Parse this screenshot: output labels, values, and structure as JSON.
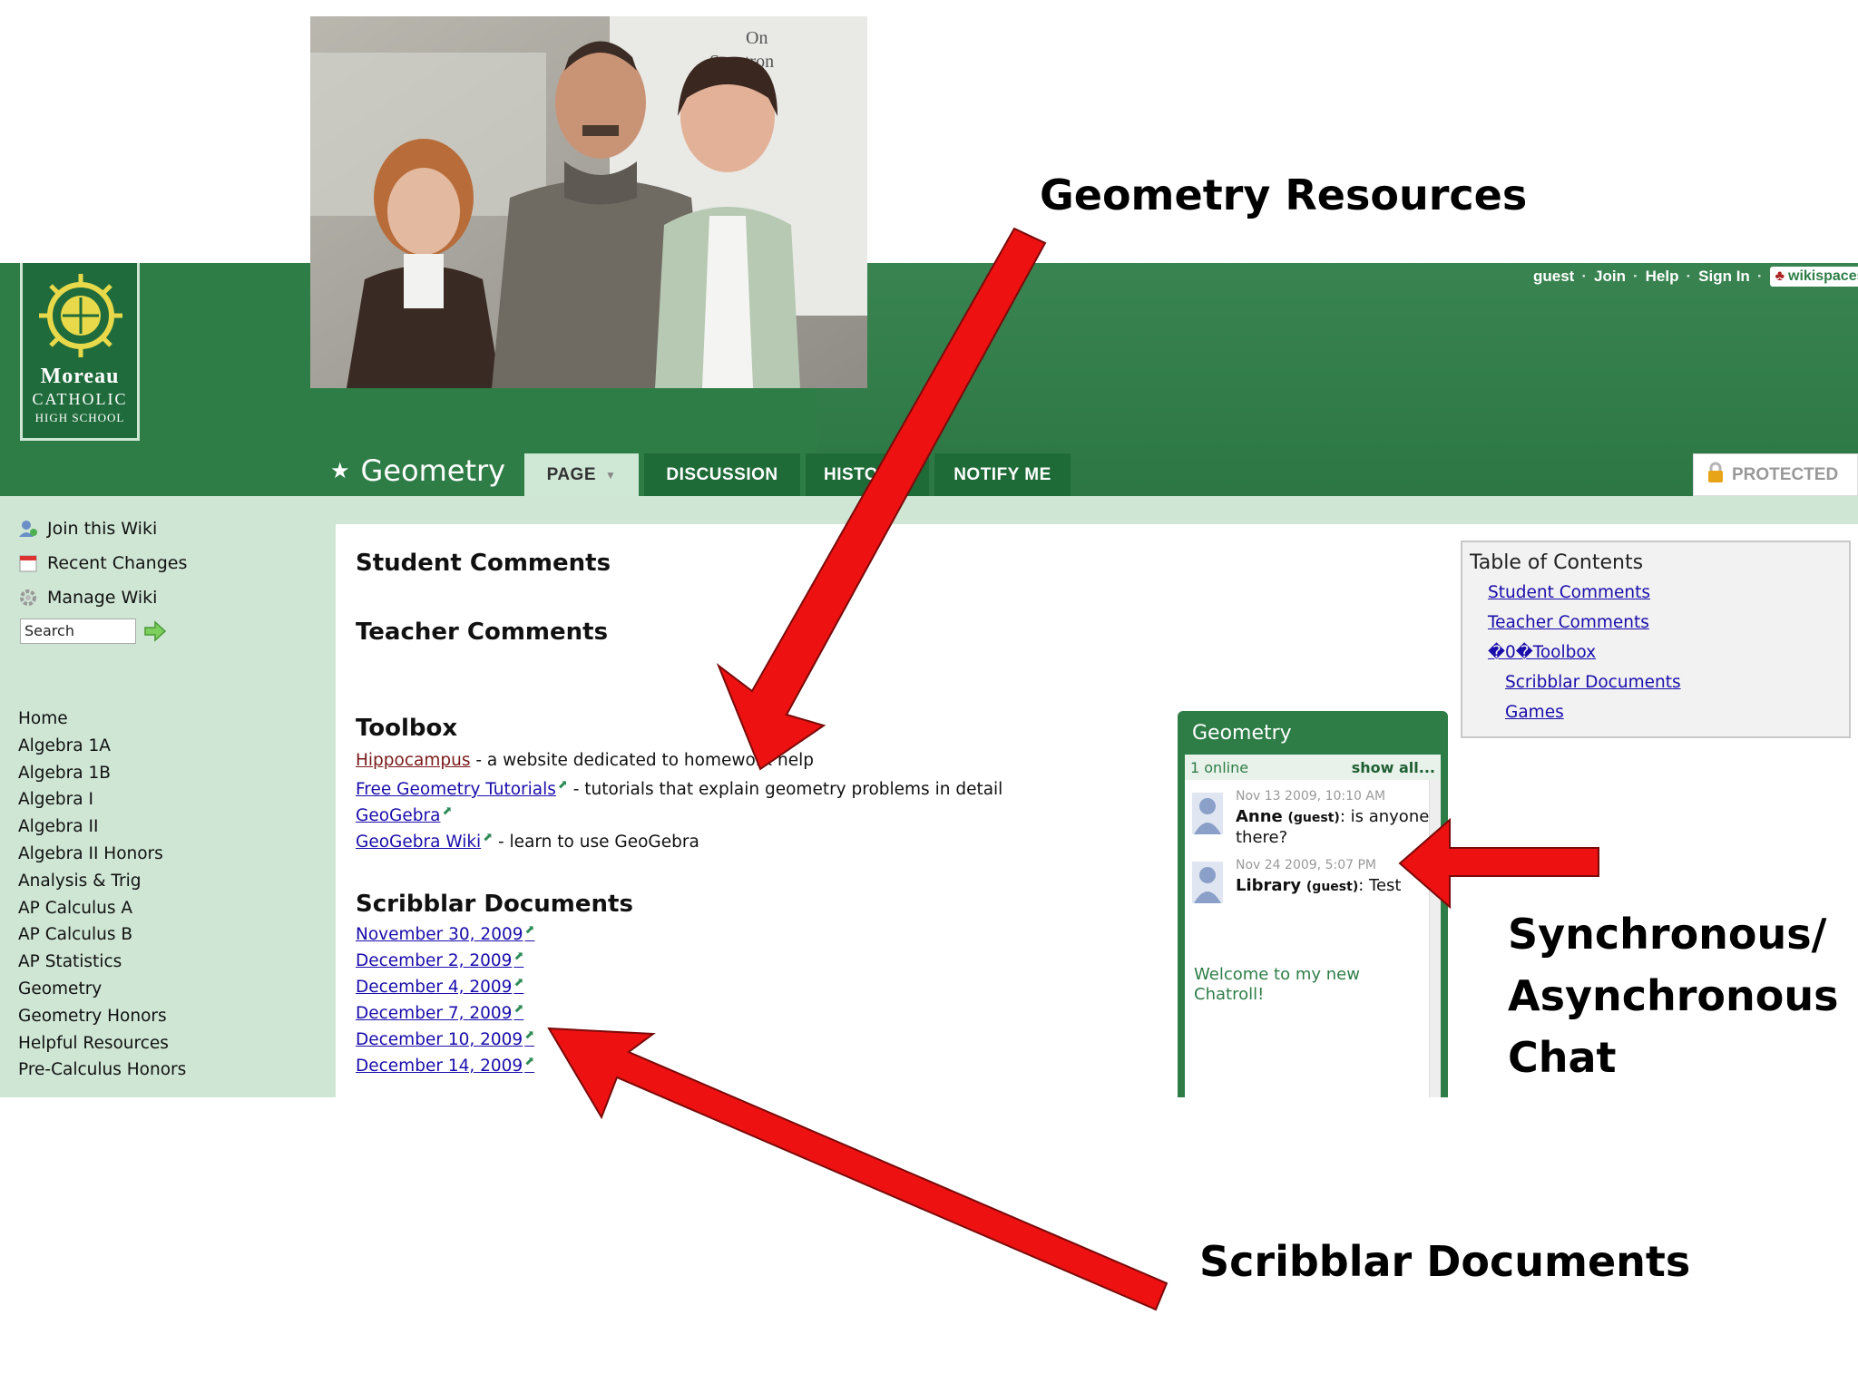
{
  "logo": {
    "line1": "Moreau",
    "line2": "CATHOLIC",
    "line3": "HIGH SCHOOL"
  },
  "user_links": {
    "guest": "guest",
    "join": "Join",
    "help": "Help",
    "sign_in": "Sign In",
    "wikispaces": "wikispaces"
  },
  "page": {
    "title": "Geometry"
  },
  "tabs": {
    "page": "PAGE",
    "discussion": "DISCUSSION",
    "history": "HISTO",
    "notify": "NOTIFY ME",
    "protected": "PROTECTED"
  },
  "sidebar": {
    "actions": [
      "Join this Wiki",
      "Recent Changes",
      "Manage Wiki"
    ],
    "search_value": "Search",
    "nav": [
      "Home",
      "Algebra 1A",
      "Algebra 1B",
      "Algebra I",
      "Algebra II",
      "Algebra II Honors",
      "Analysis & Trig",
      "AP Calculus A",
      "AP Calculus B",
      "AP Statistics",
      "Geometry",
      "Geometry Honors",
      "Helpful Resources",
      "Pre-Calculus Honors"
    ]
  },
  "content": {
    "student_comments": "Student Comments",
    "teacher_comments": "Teacher Comments",
    "toolbox": {
      "heading": "Toolbox",
      "items": [
        {
          "link": "Hippocampus",
          "desc": " - a website dedicated to homework help"
        },
        {
          "link": "Free Geometry Tutorials",
          "desc": " - tutorials that explain geometry problems in detail"
        },
        {
          "link": "GeoGebra",
          "desc": ""
        },
        {
          "link": "GeoGebra Wiki",
          "desc": " - learn to use GeoGebra"
        }
      ]
    },
    "scribblar": {
      "heading": "Scribblar Documents",
      "dates": [
        "November 30, 2009",
        "December 2, 2009",
        "December 4, 2009",
        "December 7, 2009",
        "December 10, 2009",
        "December 14, 2009"
      ]
    }
  },
  "toc": {
    "title": "Table of Contents",
    "items": [
      "Student Comments",
      "Teacher Comments",
      "�0�Toolbox",
      "Scribblar Documents",
      "Games"
    ]
  },
  "chat": {
    "title": "Geometry",
    "online": "1 online",
    "show_all": "show all...",
    "messages": [
      {
        "time": "Nov 13 2009, 10:10 AM",
        "user": "Anne",
        "tag": "(guest)",
        "text": ": is anyone there?"
      },
      {
        "time": "Nov 24 2009, 5:07 PM",
        "user": "Library",
        "tag": "(guest)",
        "text": ": Test"
      }
    ],
    "welcome": "Welcome to my new Chatroll!"
  },
  "annotations": {
    "geometry_resources": "Geometry Resources",
    "chat_line1": "Synchronous/",
    "chat_line2": "Asynchronous",
    "chat_line3": "Chat",
    "scribblar": "Scribblar Documents"
  },
  "colors": {
    "header_green": "#2e7d47",
    "sidebar_green": "#cfe6d4",
    "link_blue": "#1a0dab",
    "arrow_red": "#ee1111"
  }
}
